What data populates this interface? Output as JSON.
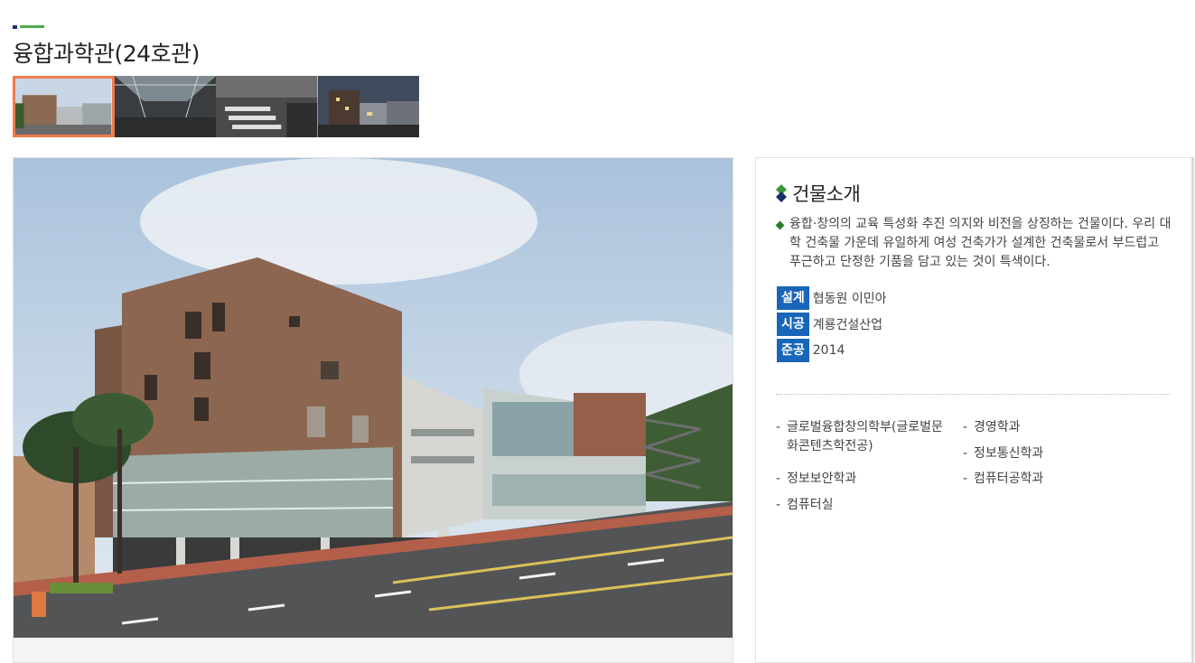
{
  "page": {
    "title": "융합과학관(24호관)"
  },
  "thumbnails": [
    {
      "name": "exterior-day-thumbnail",
      "active": true
    },
    {
      "name": "atrium-thumbnail",
      "active": false
    },
    {
      "name": "lecture-hall-thumbnail",
      "active": false
    },
    {
      "name": "exterior-dusk-thumbnail",
      "active": false
    }
  ],
  "info": {
    "heading": "건물소개",
    "description": "융합·창의의 교육 특성화 추진 의지와 비전을 상징하는 건물이다. 우리 대학 건축물 가운데 유일하게 여성 건축가가 설계한 건축물로서 부드럽고 푸근하고 단정한 기품을 담고 있는 것이 특색이다.",
    "design_label": "설계",
    "design_value": "협동원 이민아",
    "construct_label": "시공",
    "construct_value": "계룡건설산업",
    "complete_label": "준공",
    "complete_value": "2014",
    "departments": {
      "d1_line1": "글로벌융합창의학부(글로벌문",
      "d1_line2": "화콘텐츠학전공)",
      "d2": "경영학과",
      "d3": "정보통신학과",
      "d4": "정보보안학과",
      "d5": "컴퓨터공학과",
      "d6": "컴퓨터실"
    },
    "dash": "-"
  },
  "colors": {
    "tag_bg": "#1966b8",
    "active_thumb_border": "#f07a4a",
    "accent_green": "#4cae4c",
    "accent_navy": "#1b2f6a"
  }
}
